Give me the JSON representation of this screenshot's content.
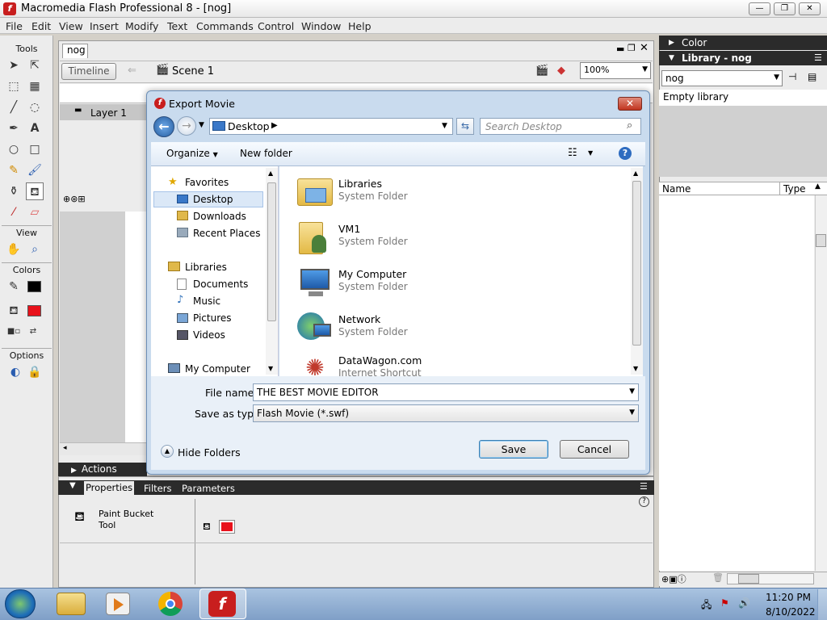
{
  "window": {
    "title": "Macromedia Flash Professional 8 - [nog]",
    "app_icon_glyph": "f"
  },
  "menu": [
    "File",
    "Edit",
    "View",
    "Insert",
    "Modify",
    "Text",
    "Commands",
    "Control",
    "Window",
    "Help"
  ],
  "tools": {
    "title": "Tools",
    "view_label": "View",
    "colors_label": "Colors",
    "options_label": "Options"
  },
  "document": {
    "tab": "nog",
    "timeline_button": "Timeline",
    "scene": "Scene 1",
    "zoom": "100%",
    "layer": "Layer 1"
  },
  "dialog": {
    "title": "Export Movie",
    "address": "Desktop",
    "search_placeholder": "Search Desktop",
    "organize": "Organize",
    "new_folder": "New folder",
    "nav": {
      "favorites": "Favorites",
      "favorites_items": [
        "Desktop",
        "Downloads",
        "Recent Places"
      ],
      "libraries": "Libraries",
      "libraries_items": [
        "Documents",
        "Music",
        "Pictures",
        "Videos"
      ],
      "computer": "My Computer"
    },
    "files": [
      {
        "name": "Libraries",
        "type": "System Folder"
      },
      {
        "name": "VM1",
        "type": "System Folder"
      },
      {
        "name": "My Computer",
        "type": "System Folder"
      },
      {
        "name": "Network",
        "type": "System Folder"
      },
      {
        "name": "DataWagon.com",
        "type": "Internet Shortcut"
      }
    ],
    "file_name_label": "File name:",
    "file_name_value": "THE BEST MOVIE EDITOR",
    "save_type_label": "Save as type:",
    "save_type_value": "Flash Movie (*.swf)",
    "hide_folders": "Hide Folders",
    "save_button": "Save",
    "cancel_button": "Cancel"
  },
  "panels": {
    "color": "Color",
    "library": "Library - nog",
    "library_select": "nog",
    "empty": "Empty library",
    "col_name": "Name",
    "col_type": "Type"
  },
  "bottom": {
    "actions": "Actions",
    "tabs": [
      "Properties",
      "Filters",
      "Parameters"
    ],
    "tool_name": "Paint Bucket Tool"
  },
  "taskbar": {
    "time": "11:20 PM",
    "date": "8/10/2022"
  },
  "colors": {
    "accent_red": "#e8111b",
    "title_gray": "#ececec",
    "dialog_blue": "#c9dbee"
  }
}
